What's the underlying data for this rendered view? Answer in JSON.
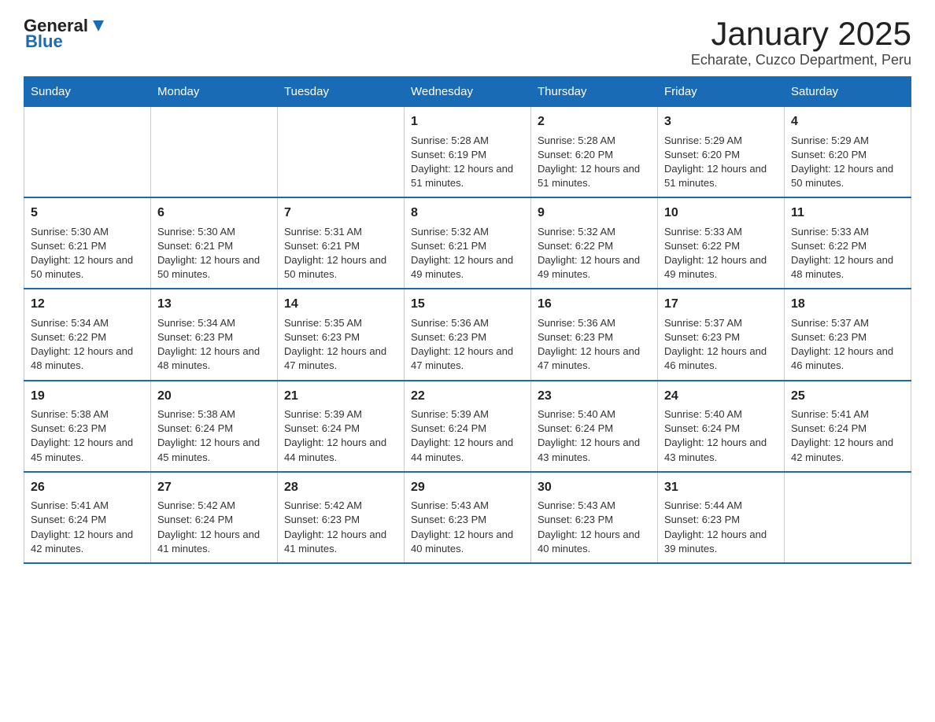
{
  "header": {
    "logo_general": "General",
    "logo_blue": "Blue",
    "title": "January 2025",
    "subtitle": "Echarate, Cuzco Department, Peru"
  },
  "days_of_week": [
    "Sunday",
    "Monday",
    "Tuesday",
    "Wednesday",
    "Thursday",
    "Friday",
    "Saturday"
  ],
  "weeks": [
    [
      {
        "day": "",
        "info": ""
      },
      {
        "day": "",
        "info": ""
      },
      {
        "day": "",
        "info": ""
      },
      {
        "day": "1",
        "info": "Sunrise: 5:28 AM\nSunset: 6:19 PM\nDaylight: 12 hours and 51 minutes."
      },
      {
        "day": "2",
        "info": "Sunrise: 5:28 AM\nSunset: 6:20 PM\nDaylight: 12 hours and 51 minutes."
      },
      {
        "day": "3",
        "info": "Sunrise: 5:29 AM\nSunset: 6:20 PM\nDaylight: 12 hours and 51 minutes."
      },
      {
        "day": "4",
        "info": "Sunrise: 5:29 AM\nSunset: 6:20 PM\nDaylight: 12 hours and 50 minutes."
      }
    ],
    [
      {
        "day": "5",
        "info": "Sunrise: 5:30 AM\nSunset: 6:21 PM\nDaylight: 12 hours and 50 minutes."
      },
      {
        "day": "6",
        "info": "Sunrise: 5:30 AM\nSunset: 6:21 PM\nDaylight: 12 hours and 50 minutes."
      },
      {
        "day": "7",
        "info": "Sunrise: 5:31 AM\nSunset: 6:21 PM\nDaylight: 12 hours and 50 minutes."
      },
      {
        "day": "8",
        "info": "Sunrise: 5:32 AM\nSunset: 6:21 PM\nDaylight: 12 hours and 49 minutes."
      },
      {
        "day": "9",
        "info": "Sunrise: 5:32 AM\nSunset: 6:22 PM\nDaylight: 12 hours and 49 minutes."
      },
      {
        "day": "10",
        "info": "Sunrise: 5:33 AM\nSunset: 6:22 PM\nDaylight: 12 hours and 49 minutes."
      },
      {
        "day": "11",
        "info": "Sunrise: 5:33 AM\nSunset: 6:22 PM\nDaylight: 12 hours and 48 minutes."
      }
    ],
    [
      {
        "day": "12",
        "info": "Sunrise: 5:34 AM\nSunset: 6:22 PM\nDaylight: 12 hours and 48 minutes."
      },
      {
        "day": "13",
        "info": "Sunrise: 5:34 AM\nSunset: 6:23 PM\nDaylight: 12 hours and 48 minutes."
      },
      {
        "day": "14",
        "info": "Sunrise: 5:35 AM\nSunset: 6:23 PM\nDaylight: 12 hours and 47 minutes."
      },
      {
        "day": "15",
        "info": "Sunrise: 5:36 AM\nSunset: 6:23 PM\nDaylight: 12 hours and 47 minutes."
      },
      {
        "day": "16",
        "info": "Sunrise: 5:36 AM\nSunset: 6:23 PM\nDaylight: 12 hours and 47 minutes."
      },
      {
        "day": "17",
        "info": "Sunrise: 5:37 AM\nSunset: 6:23 PM\nDaylight: 12 hours and 46 minutes."
      },
      {
        "day": "18",
        "info": "Sunrise: 5:37 AM\nSunset: 6:23 PM\nDaylight: 12 hours and 46 minutes."
      }
    ],
    [
      {
        "day": "19",
        "info": "Sunrise: 5:38 AM\nSunset: 6:23 PM\nDaylight: 12 hours and 45 minutes."
      },
      {
        "day": "20",
        "info": "Sunrise: 5:38 AM\nSunset: 6:24 PM\nDaylight: 12 hours and 45 minutes."
      },
      {
        "day": "21",
        "info": "Sunrise: 5:39 AM\nSunset: 6:24 PM\nDaylight: 12 hours and 44 minutes."
      },
      {
        "day": "22",
        "info": "Sunrise: 5:39 AM\nSunset: 6:24 PM\nDaylight: 12 hours and 44 minutes."
      },
      {
        "day": "23",
        "info": "Sunrise: 5:40 AM\nSunset: 6:24 PM\nDaylight: 12 hours and 43 minutes."
      },
      {
        "day": "24",
        "info": "Sunrise: 5:40 AM\nSunset: 6:24 PM\nDaylight: 12 hours and 43 minutes."
      },
      {
        "day": "25",
        "info": "Sunrise: 5:41 AM\nSunset: 6:24 PM\nDaylight: 12 hours and 42 minutes."
      }
    ],
    [
      {
        "day": "26",
        "info": "Sunrise: 5:41 AM\nSunset: 6:24 PM\nDaylight: 12 hours and 42 minutes."
      },
      {
        "day": "27",
        "info": "Sunrise: 5:42 AM\nSunset: 6:24 PM\nDaylight: 12 hours and 41 minutes."
      },
      {
        "day": "28",
        "info": "Sunrise: 5:42 AM\nSunset: 6:23 PM\nDaylight: 12 hours and 41 minutes."
      },
      {
        "day": "29",
        "info": "Sunrise: 5:43 AM\nSunset: 6:23 PM\nDaylight: 12 hours and 40 minutes."
      },
      {
        "day": "30",
        "info": "Sunrise: 5:43 AM\nSunset: 6:23 PM\nDaylight: 12 hours and 40 minutes."
      },
      {
        "day": "31",
        "info": "Sunrise: 5:44 AM\nSunset: 6:23 PM\nDaylight: 12 hours and 39 minutes."
      },
      {
        "day": "",
        "info": ""
      }
    ]
  ]
}
